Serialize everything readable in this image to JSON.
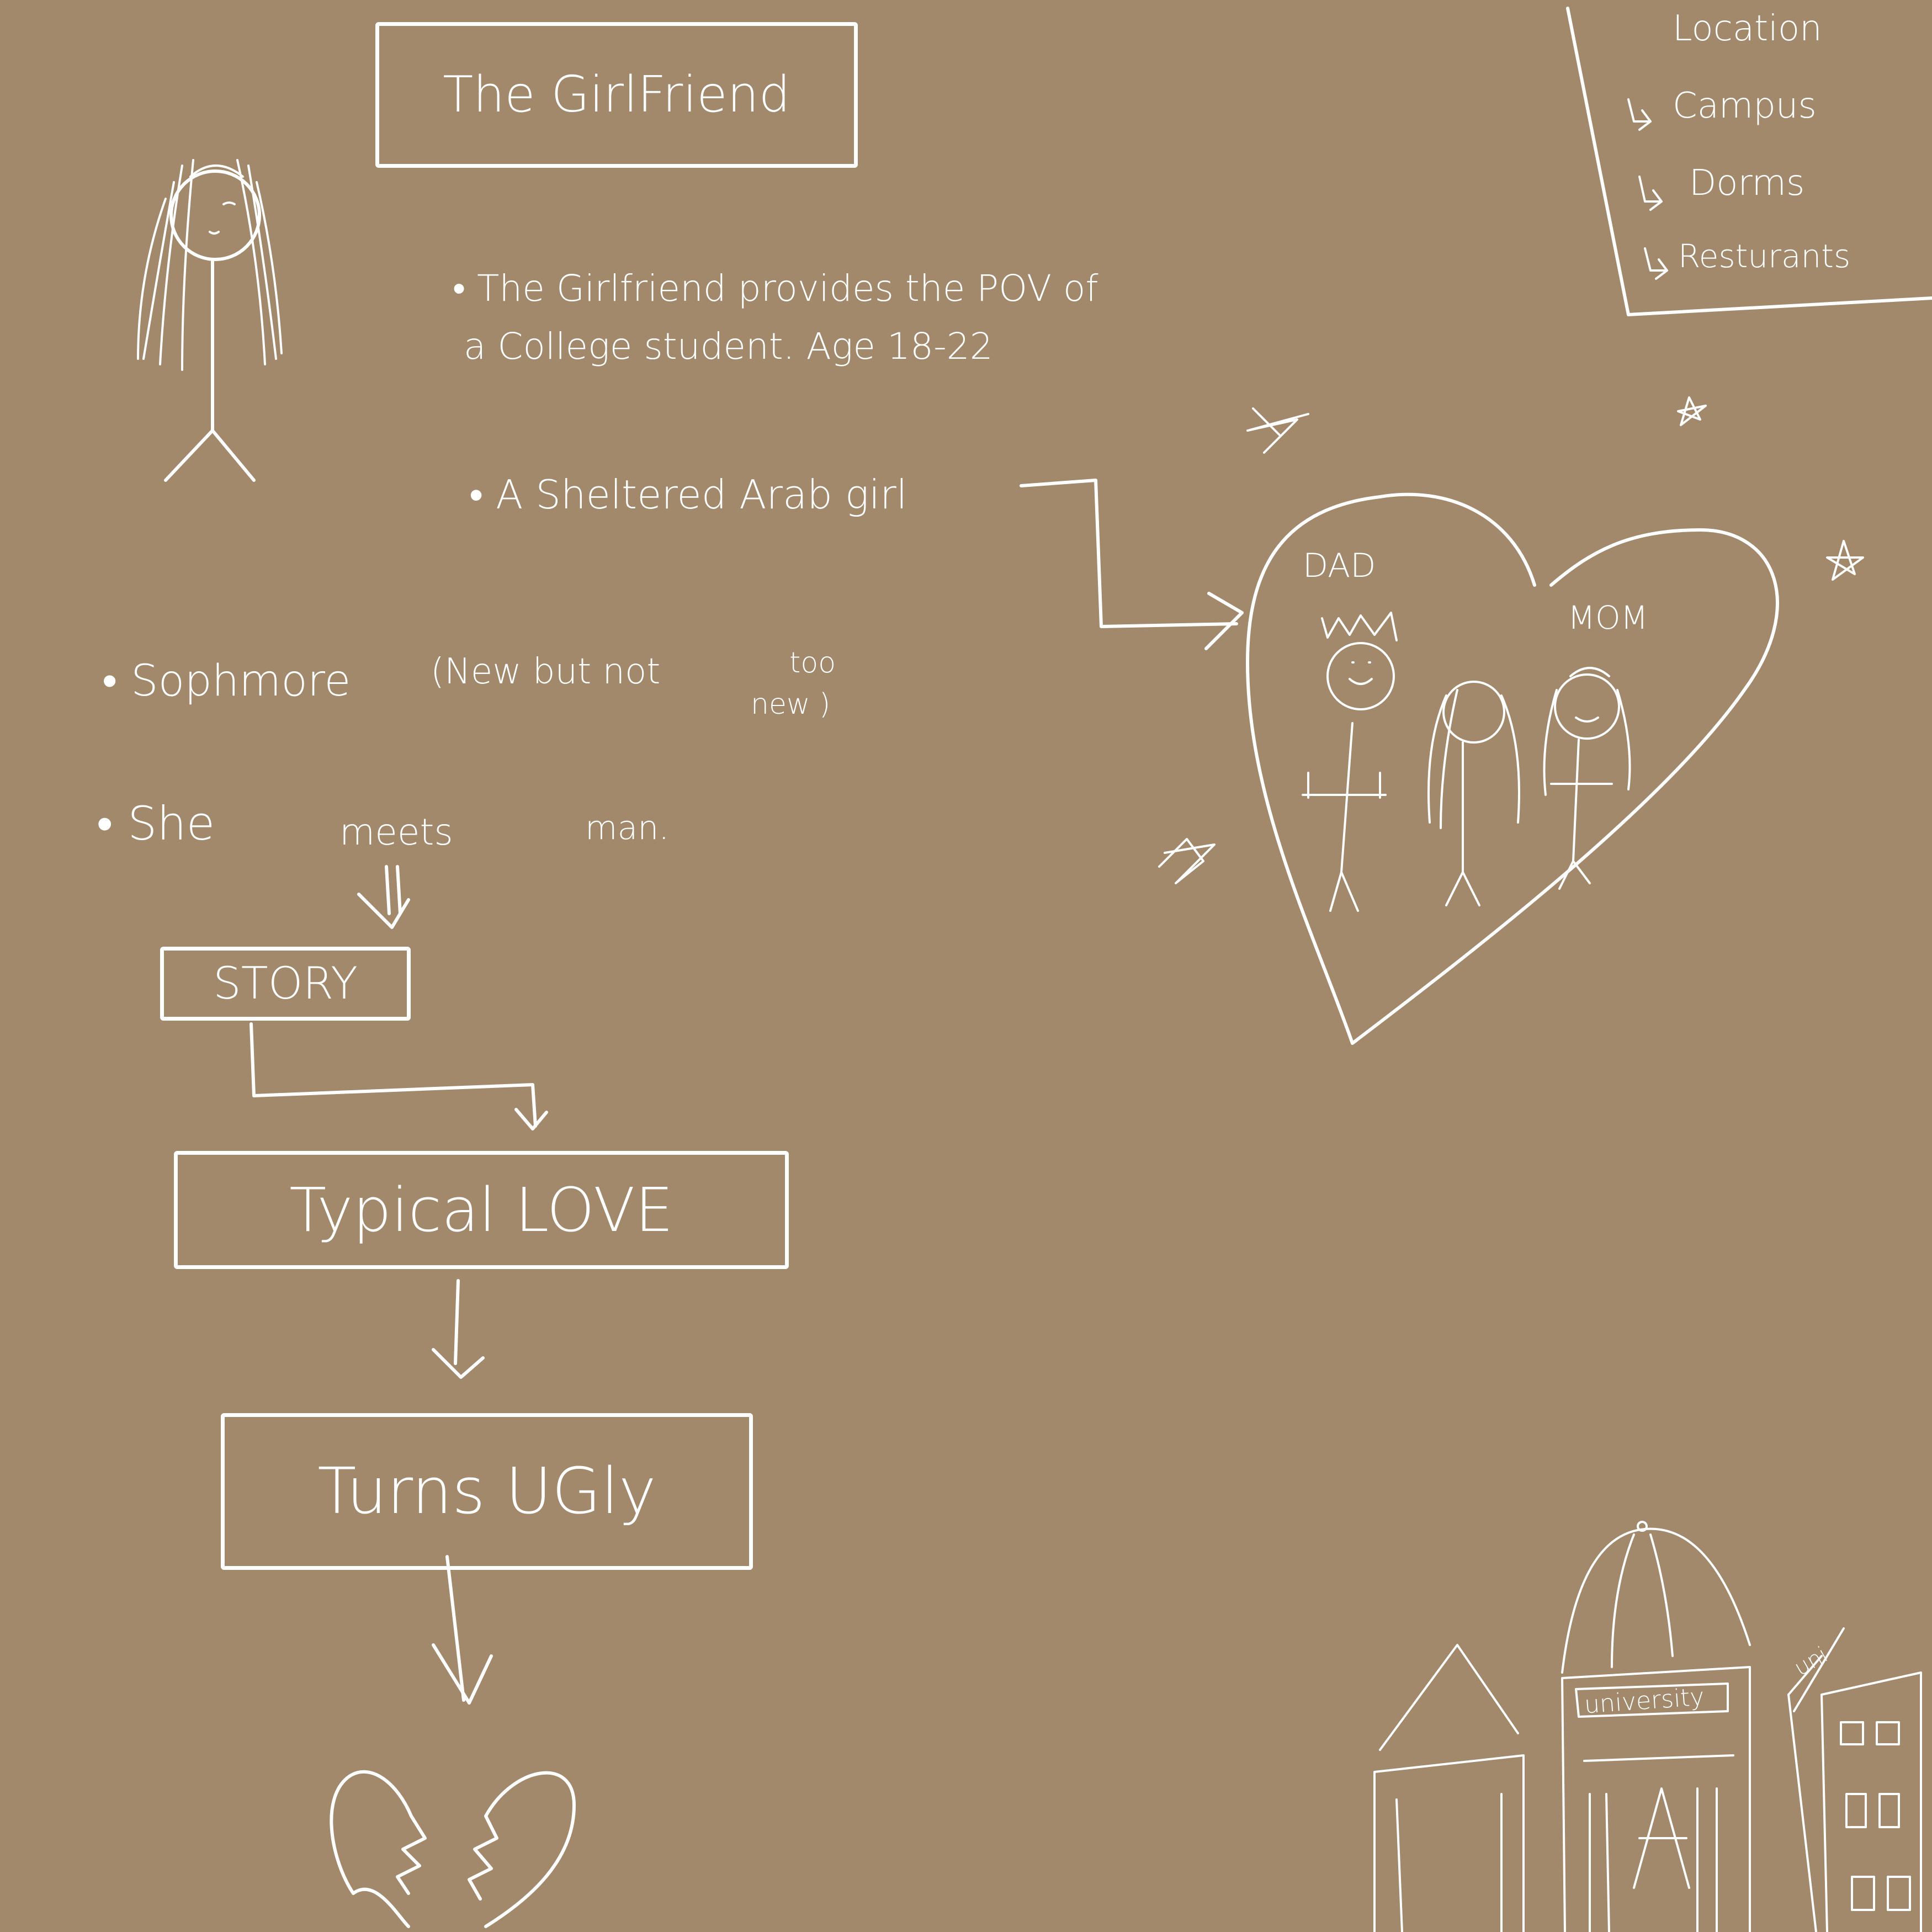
{
  "title": "The GirlFriend",
  "bullets": {
    "pov_line1": "The Girlfriend provides the POV of",
    "pov_line2": "a College student. Age 18-22",
    "sheltered": "A Sheltered Arab girl",
    "sophmore": "Sophmore",
    "sophmore_note_1": "(New but not",
    "sophmore_note_2": "too",
    "sophmore_note_3": "new )",
    "meets": "She",
    "meets_2": "meets",
    "meets_3": "man."
  },
  "location": {
    "heading": "Location",
    "items": [
      "Campus",
      "Dorms",
      "Resturants"
    ]
  },
  "family": {
    "dad_label": "DAD",
    "mom_label": "MOM"
  },
  "flow": {
    "story": "STORY",
    "typical_love": "Typical LOVE",
    "turns_ugly": "Turns UGly"
  },
  "building": {
    "sign": "university",
    "side_sign": "uni"
  },
  "colors": {
    "background": "#a3896c",
    "ink": "#ffffff"
  }
}
